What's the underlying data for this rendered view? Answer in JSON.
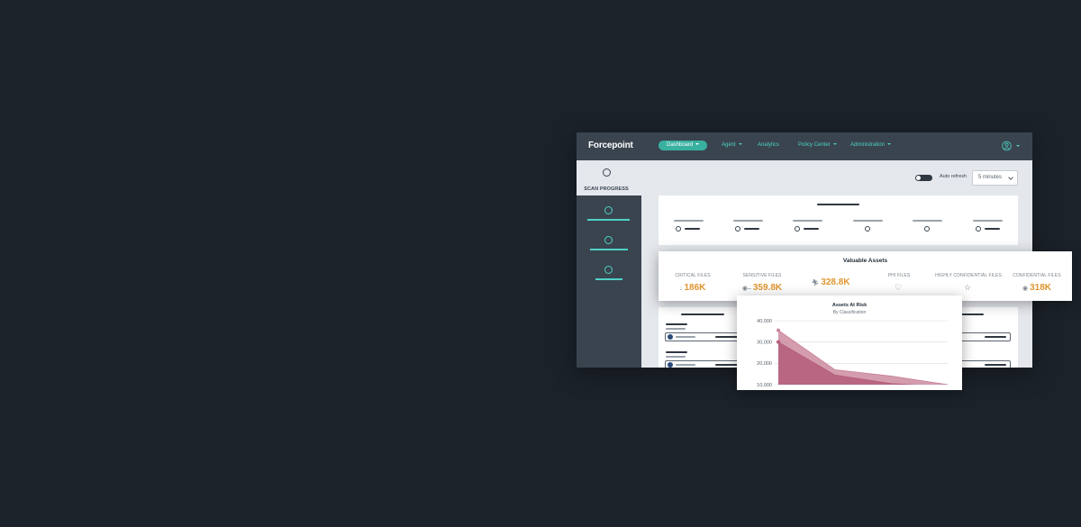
{
  "app": {
    "logo": "Forcepoint",
    "nav": [
      {
        "label": "Dashboard",
        "active": true
      },
      {
        "label": "Agent",
        "active": false
      },
      {
        "label": "Analytics",
        "active": false
      },
      {
        "label": "Policy Center",
        "active": false
      },
      {
        "label": "Administration",
        "active": false
      }
    ],
    "user_icon": "user-circle-icon",
    "scan_progress_label": "SCAN PROGRESS",
    "auto_refresh_label": "Auto refresh",
    "refresh_interval": "5 minutes"
  },
  "valuable_assets": {
    "title": "Valuable Assets",
    "stats": [
      {
        "name": "CRITICAL FILES",
        "value": "186K",
        "icon": "drop-icon"
      },
      {
        "name": "SENSITIVE FILES",
        "value": "359.8K",
        "icon": "eye-icon"
      },
      {
        "name": "",
        "value": "328.8K",
        "icon": "figure-icon"
      },
      {
        "name": "PHI FILES",
        "value": "",
        "icon": "heart-icon"
      },
      {
        "name": "HIGHLY CONFIDENTIAL FILES",
        "value": "",
        "icon": "star-icon"
      },
      {
        "name": "CONFIDENTIAL FILES",
        "value": "318K",
        "icon": "target-icon"
      }
    ]
  },
  "chart_data": {
    "type": "area",
    "title": "Assets At Risk",
    "subtitle": "By Classification",
    "ytick_labels": [
      "10,000",
      "20,000",
      "30,000",
      "40,000"
    ],
    "ylim": [
      10000,
      40000
    ],
    "grid": true,
    "series": [
      {
        "values": [
          35500,
          17000,
          14000,
          10000
        ],
        "color": "#c9859a"
      },
      {
        "values": [
          30000,
          14500,
          10500,
          9000
        ],
        "color": "#b45d7a"
      }
    ]
  }
}
